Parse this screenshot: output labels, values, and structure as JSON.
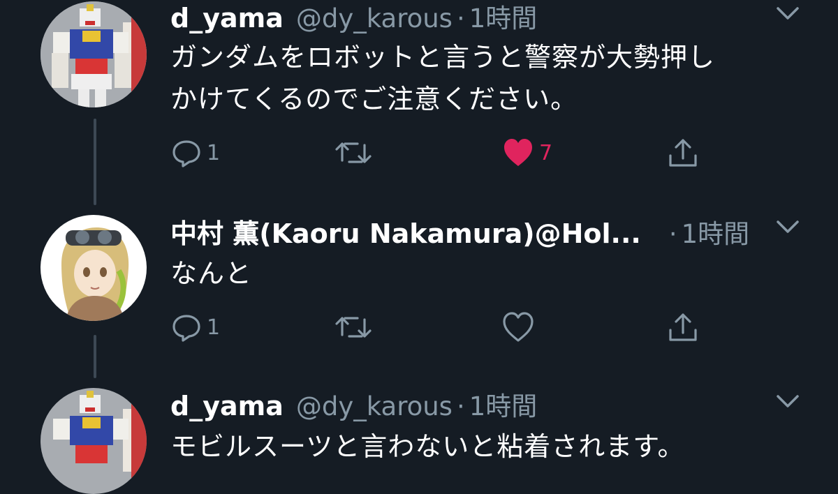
{
  "tweets": [
    {
      "name": "d_yama",
      "handle": "@dy_karous",
      "sep": "·",
      "time": "1時間",
      "text_lines": [
        "ガンダムをロボットと言うと警察が大勢押し",
        "かけてくるのでご注意ください。"
      ],
      "actions": {
        "reply_count": "1",
        "retweet_count": "",
        "like_count": "7",
        "liked": true
      },
      "avatar": "gundam-avatar"
    },
    {
      "name": "中村 薫(Kaoru Nakamura)@Hol...",
      "handle": "",
      "sep": "·",
      "time": "1時間",
      "text_lines": [
        "なんと"
      ],
      "actions": {
        "reply_count": "1",
        "retweet_count": "",
        "like_count": "",
        "liked": false
      },
      "avatar": "anime-avatar"
    },
    {
      "name": "d_yama",
      "handle": "@dy_karous",
      "sep": "·",
      "time": "1時間",
      "text_lines": [
        "モビルスーツと言わないと粘着されます。"
      ],
      "avatar": "gundam-avatar"
    }
  ],
  "colors": {
    "background": "#151c24",
    "secondary_text": "#8899a6",
    "like_active": "#e0245e",
    "thread_line": "#3d4955"
  }
}
